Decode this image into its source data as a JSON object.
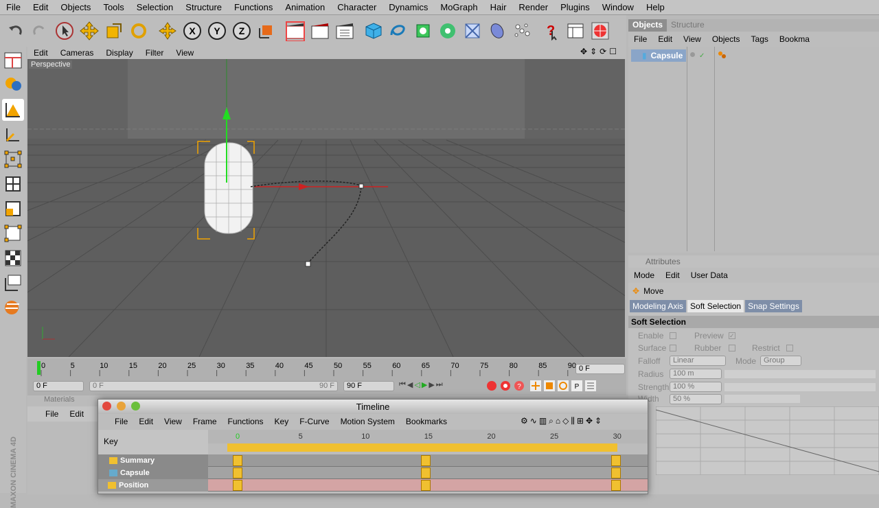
{
  "menubar": {
    "items": [
      "File",
      "Edit",
      "Objects",
      "Tools",
      "Selection",
      "Structure",
      "Functions",
      "Animation",
      "Character",
      "Dynamics",
      "MoGraph",
      "Hair",
      "Render",
      "Plugins",
      "Window",
      "Help"
    ]
  },
  "viewport": {
    "menu": [
      "Edit",
      "Cameras",
      "Display",
      "Filter",
      "View"
    ],
    "label": "Perspective"
  },
  "timeline": {
    "ticks": [
      "0",
      "5",
      "10",
      "15",
      "20",
      "25",
      "30",
      "35",
      "40",
      "45",
      "50",
      "55",
      "60",
      "65",
      "70",
      "75",
      "80",
      "85",
      "90"
    ],
    "current_frame": "0 F",
    "start": "0 F",
    "min": "0 F",
    "max": "90 F",
    "end": "90 F"
  },
  "objects_panel": {
    "tabs": [
      "Objects",
      "Structure"
    ],
    "menu": [
      "File",
      "Edit",
      "View",
      "Objects",
      "Tags",
      "Bookma"
    ],
    "object_name": "Capsule"
  },
  "attributes": {
    "title": "Attributes",
    "menu": [
      "Mode",
      "Edit",
      "User Data"
    ],
    "tool": "Move",
    "tabs": [
      "Modeling Axis",
      "Soft Selection",
      "Snap Settings"
    ],
    "section": "Soft Selection",
    "enable": "Enable",
    "preview": "Preview",
    "surface": "Surface",
    "rubber": "Rubber",
    "restrict": "Restrict",
    "falloff_label": "Falloff",
    "falloff_value": "Linear",
    "mode_label": "Mode",
    "mode_value": "Group",
    "radius_label": "Radius",
    "radius_value": "100 m",
    "strength_label": "Strength",
    "strength_value": "100 %",
    "width_label": "Width",
    "width_value": "50 %"
  },
  "materials": {
    "title": "Materials",
    "menu": [
      "File",
      "Edit"
    ]
  },
  "timeline_window": {
    "title": "Timeline",
    "menu": [
      "File",
      "Edit",
      "View",
      "Frame",
      "Functions",
      "Key",
      "F-Curve",
      "Motion System",
      "Bookmarks"
    ],
    "key_header": "Key",
    "ticks": [
      "0",
      "5",
      "10",
      "15",
      "20",
      "25",
      "30"
    ],
    "tracks": [
      {
        "name": "Summary"
      },
      {
        "name": "Capsule"
      },
      {
        "name": "Position"
      }
    ]
  },
  "brand": "MAXON CINEMA 4D"
}
